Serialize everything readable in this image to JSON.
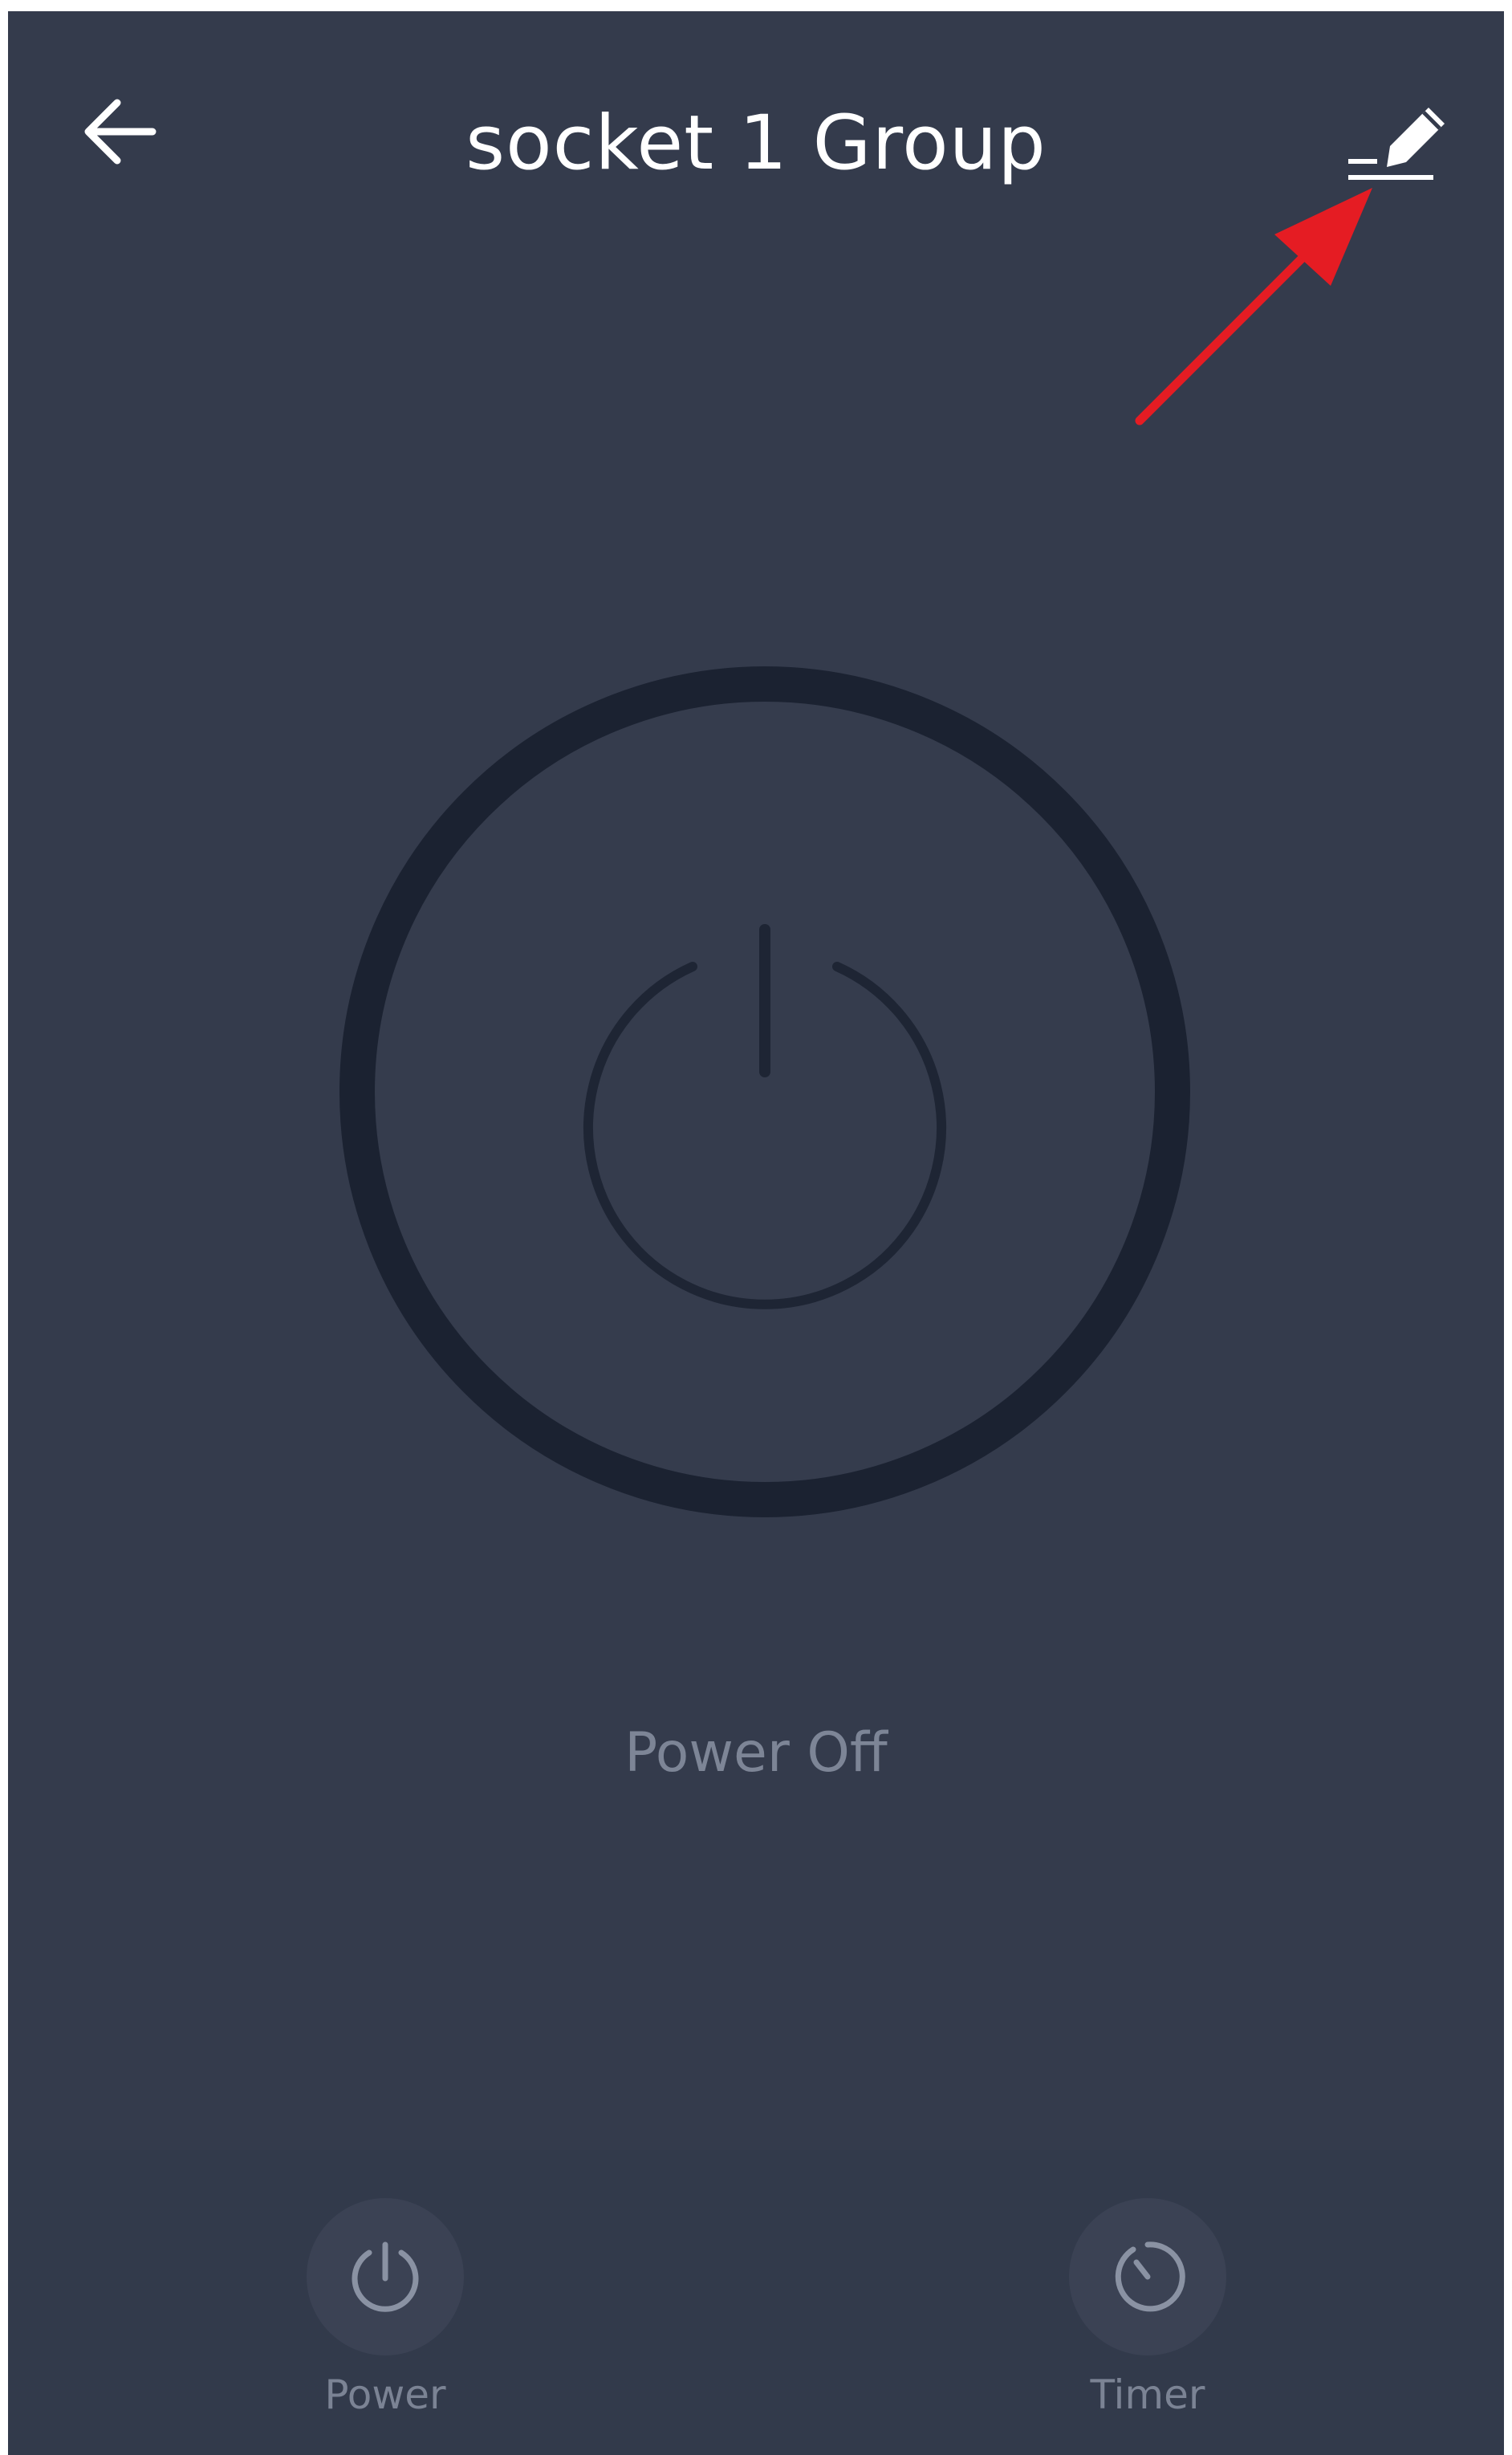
{
  "header": {
    "title": "socket 1 Group",
    "back_icon": "arrow-left-icon",
    "edit_icon": "pencil-edit-icon"
  },
  "main": {
    "power_icon": "power-icon",
    "status_text": "Power Off",
    "switch_state": "off"
  },
  "bottom_tabs": [
    {
      "label": "Power",
      "icon": "power-icon"
    },
    {
      "label": "Timer",
      "icon": "timer-icon"
    }
  ],
  "annotation": {
    "arrow_color": "#e51c23",
    "points_to": "edit-button"
  },
  "colors": {
    "background": "#343b4c",
    "ring": "#1b2231",
    "button_face": "#353c4d",
    "text_primary": "#ffffff",
    "text_muted": "#7d8596",
    "tab_circle": "#3b4254"
  }
}
